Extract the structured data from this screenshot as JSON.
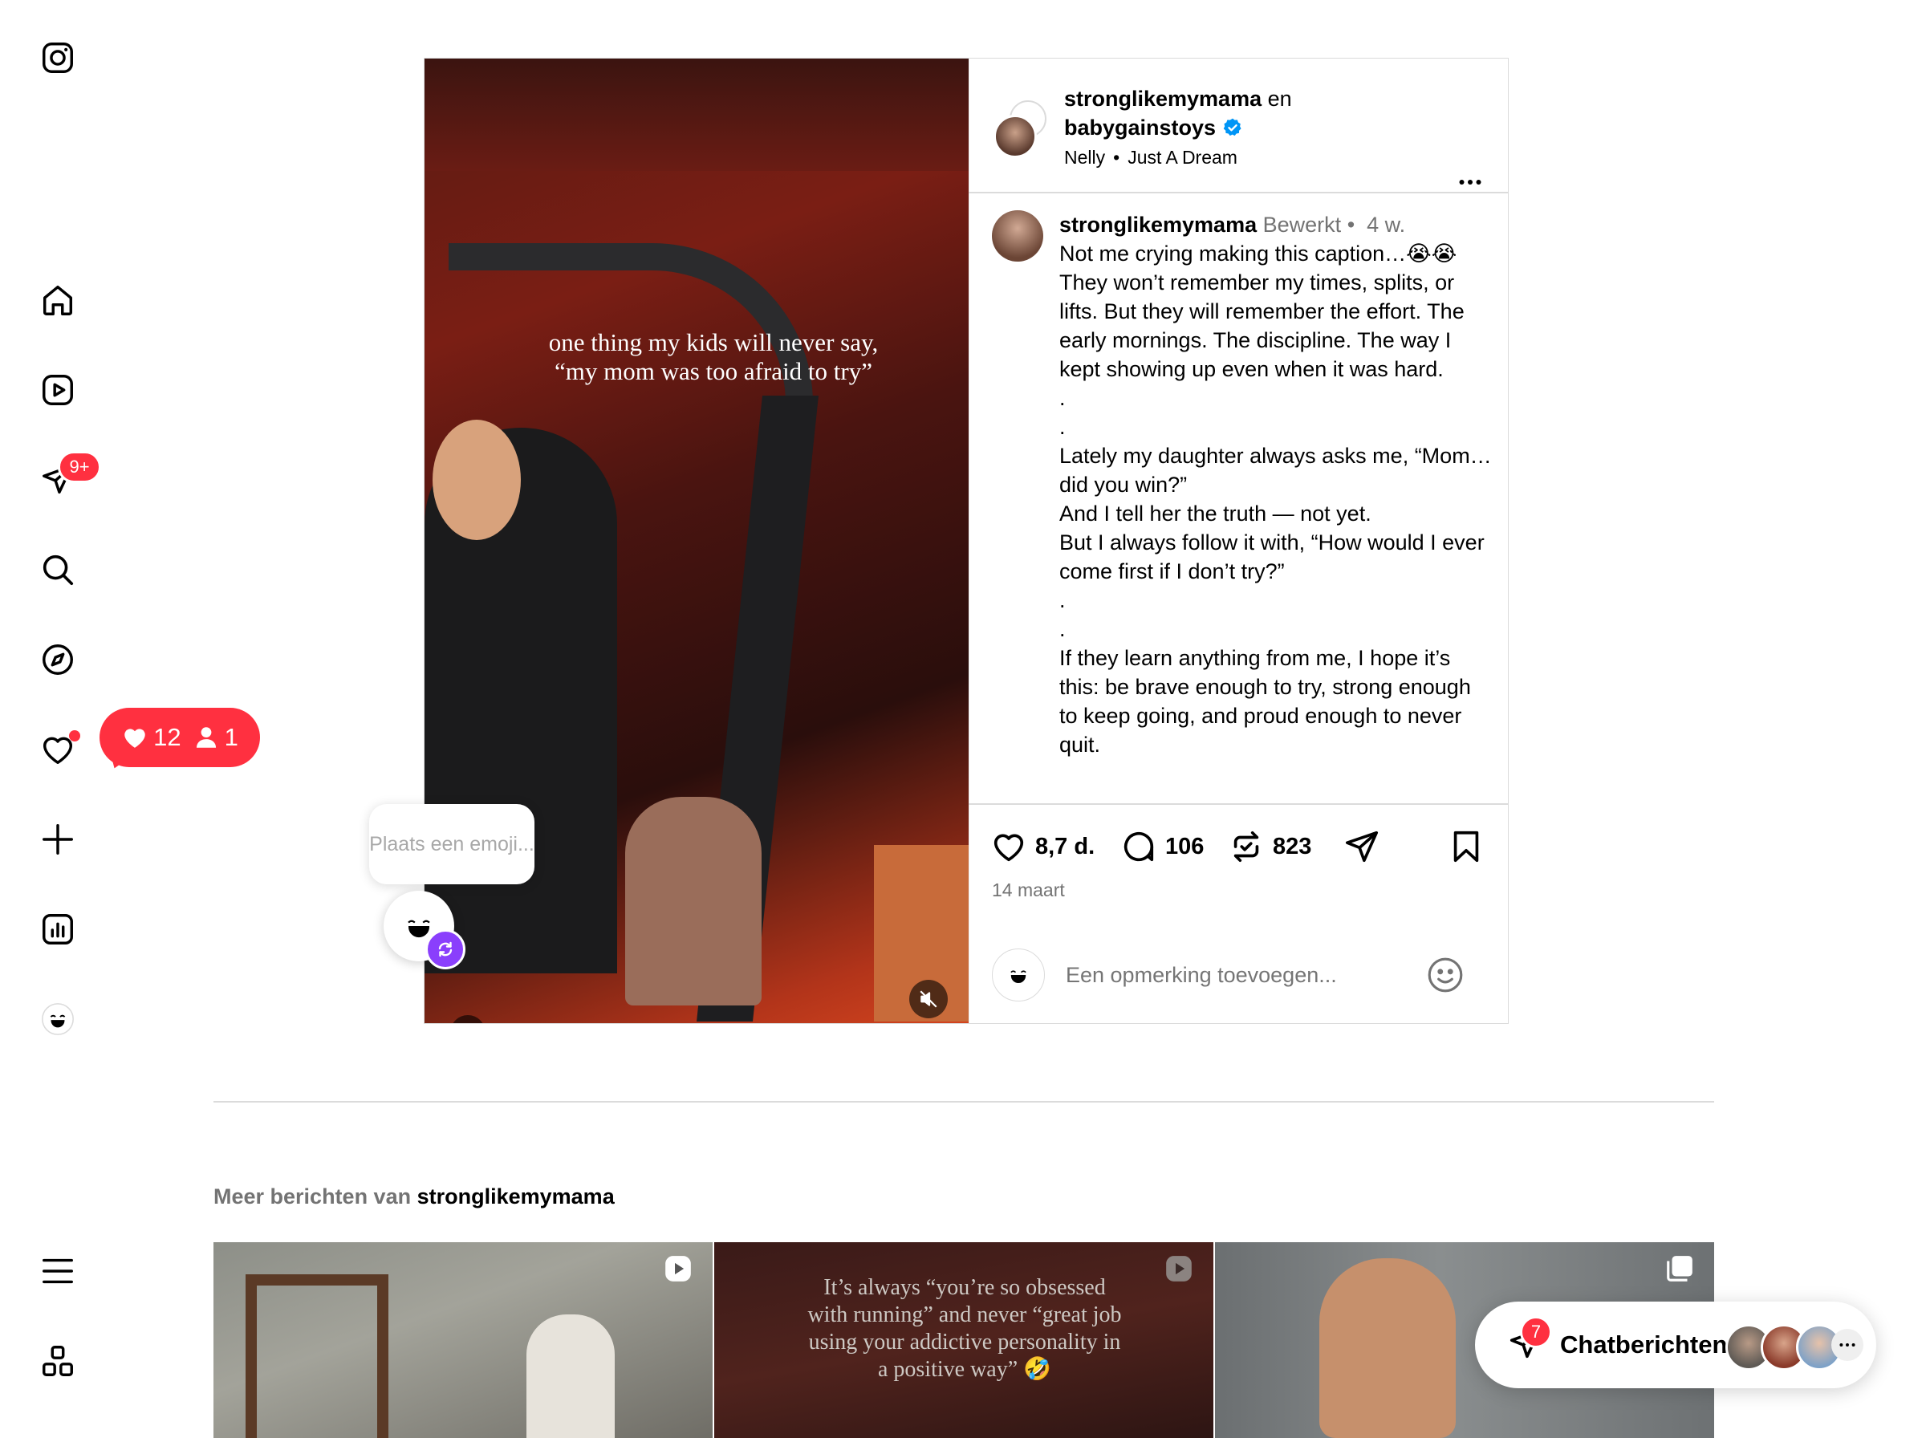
{
  "sidebar": {
    "messages_badge": "9+",
    "notification_counts": {
      "likes": "12",
      "follows": "1"
    }
  },
  "post": {
    "header": {
      "author": "stronglikemymama",
      "connector": "en",
      "collaborator": "babygainstoys",
      "audio_artist": "Nelly",
      "audio_separator": "•",
      "audio_title": "Just A Dream"
    },
    "media": {
      "overlay_text": "one thing my kids will never say, “my mom was too afraid to try”"
    },
    "caption": {
      "username": "stronglikemymama",
      "edited": "Bewerkt",
      "separator": "•",
      "time": "4 w.",
      "text": "Not me crying making this caption…😭😭\nThey won’t remember my times, splits, or lifts. But they will remember the effort. The early mornings. The discipline. The way I kept showing up even when it was hard.\n.\n.\nLately my daughter always asks me, “Mom… did you win?”\nAnd I tell her the truth — not yet.\nBut I always follow it with, “How would I ever come first if I don’t try?”\n.\n.\nIf they learn anything from me, I hope it’s this: be brave enough to try, strong enough to keep going, and proud enough to never quit."
    },
    "actions": {
      "likes": "8,7 d.",
      "comments": "106",
      "reposts": "823"
    },
    "date": "14 maart",
    "comment_input": {
      "placeholder": "Een opmerking toevoegen..."
    }
  },
  "emoji_reaction": {
    "tooltip": "Plaats een emoji..."
  },
  "more_posts": {
    "prefix": "Meer berichten van",
    "username": "stronglikemymama",
    "tiles": [
      {
        "type": "video",
        "overlay": ""
      },
      {
        "type": "video",
        "overlay": "It’s always “you’re so obsessed with running” and never “great job using your addictive personality in a positive way” 🤣"
      },
      {
        "type": "carousel",
        "overlay": ""
      }
    ]
  },
  "chat": {
    "label": "Chatberichten",
    "badge": "7"
  },
  "colors": {
    "accent_red": "#ff3040",
    "verified_blue": "#0095f6",
    "muted_text": "#737373",
    "border": "#dbdbdb"
  }
}
